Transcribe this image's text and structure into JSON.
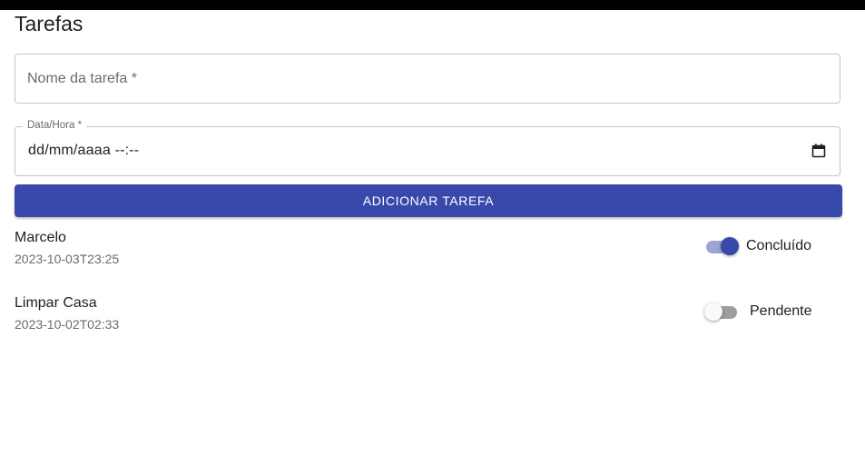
{
  "page_title": "Tarefas",
  "form": {
    "task_name_placeholder": "Nome da tarefa *",
    "datetime_label": "Data/Hora *",
    "datetime_value": "dd/mm/aaaa --:--",
    "add_button_label": "ADICIONAR TAREFA"
  },
  "tasks": [
    {
      "name": "Marcelo",
      "datetime": "2023-10-03T23:25",
      "status": "Concluído",
      "done": true
    },
    {
      "name": "Limpar Casa",
      "datetime": "2023-10-02T02:33",
      "status": "Pendente",
      "done": false
    }
  ],
  "colors": {
    "accent": "#3949ab",
    "accent_light": "#9ca4d4"
  },
  "icons": {
    "calendar": "calendar-icon"
  }
}
